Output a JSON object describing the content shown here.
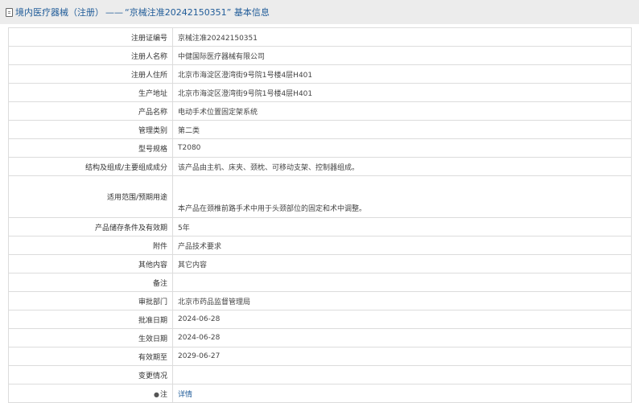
{
  "header": {
    "category": "境内医疗器械（注册）",
    "separator": "——",
    "record_title": "“京械注准20242150351” 基本信息"
  },
  "rows": [
    {
      "label": "注册证编号",
      "value": "京械注准20242150351"
    },
    {
      "label": "注册人名称",
      "value": "中健国际医疗器械有限公司"
    },
    {
      "label": "注册人住所",
      "value": "北京市海淀区澄湾街9号院1号楼4层H401"
    },
    {
      "label": "生产地址",
      "value": "北京市海淀区澄湾街9号院1号楼4层H401"
    },
    {
      "label": "产品名称",
      "value": "电动手术位置固定架系统"
    },
    {
      "label": "管理类别",
      "value": "第二类"
    },
    {
      "label": "型号规格",
      "value": "T2080"
    },
    {
      "label": "结构及组成/主要组成成分",
      "value": "该产品由主机、床夹、颈枕、可移动支架、控制器组成。"
    },
    {
      "label": "适用范围/预期用途",
      "value": "本产品在颈椎前路手术中用于头颈部位的固定和术中调整。"
    },
    {
      "label": "产品储存条件及有效期",
      "value": "5年"
    },
    {
      "label": "附件",
      "value": "产品技术要求"
    },
    {
      "label": "其他内容",
      "value": "其它内容"
    },
    {
      "label": "备注",
      "value": ""
    },
    {
      "label": "审批部门",
      "value": "北京市药品监督管理局"
    },
    {
      "label": "批准日期",
      "value": "2024-06-28"
    },
    {
      "label": "生效日期",
      "value": "2024-06-28"
    },
    {
      "label": "有效期至",
      "value": "2029-06-27"
    },
    {
      "label": "变更情况",
      "value": ""
    },
    {
      "label": "注",
      "value": "详情",
      "icon": "pin-icon"
    }
  ]
}
